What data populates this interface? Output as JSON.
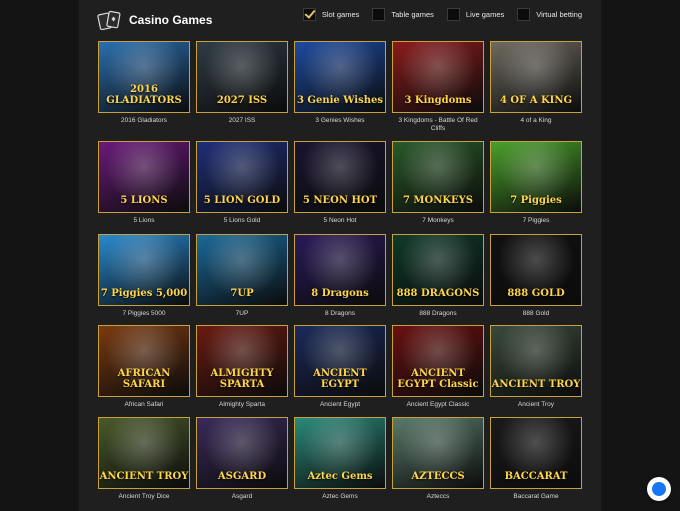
{
  "header": {
    "title": "Casino Games",
    "filters": [
      {
        "label": "Slot games",
        "checked": true
      },
      {
        "label": "Table games",
        "checked": false
      },
      {
        "label": "Live games",
        "checked": false
      },
      {
        "label": "Virtual betting",
        "checked": false
      }
    ]
  },
  "games": [
    {
      "name": "2016 Gladiators",
      "art": "2016 GLADIATORS",
      "bg": "#2a6fb0"
    },
    {
      "name": "2027 ISS",
      "art": "2027 ISS",
      "bg": "#2f3b45"
    },
    {
      "name": "3 Genies Wishes",
      "art": "3 Genie Wishes",
      "bg": "#1d4aa0"
    },
    {
      "name": "3 Kingdoms - Battle Of Red Cliffs",
      "art": "3 Kingdoms",
      "bg": "#8a1b1b"
    },
    {
      "name": "4 of a King",
      "art": "4 OF A KING",
      "bg": "#6e6a5f"
    },
    {
      "name": "5 Lions",
      "art": "5 LIONS",
      "bg": "#6a1a7a"
    },
    {
      "name": "5 Lions Gold",
      "art": "5 LION GOLD",
      "bg": "#1f2f7a"
    },
    {
      "name": "5 Neon Hot",
      "art": "5 NEON HOT",
      "bg": "#1a1430"
    },
    {
      "name": "7 Monkeys",
      "art": "7 MONKEYS",
      "bg": "#2a5a2a"
    },
    {
      "name": "7 Piggies",
      "art": "7 Piggies",
      "bg": "#4aa02a"
    },
    {
      "name": "7 Piggies 5000",
      "art": "7 Piggies 5,000",
      "bg": "#2a8ad0"
    },
    {
      "name": "7UP",
      "art": "7UP",
      "bg": "#1a6a9a"
    },
    {
      "name": "8 Dragons",
      "art": "8 Dragons",
      "bg": "#2a1a5a"
    },
    {
      "name": "888 Dragons",
      "art": "888 DRAGONS",
      "bg": "#0f3a2a"
    },
    {
      "name": "888 Gold",
      "art": "888 GOLD",
      "bg": "#111111"
    },
    {
      "name": "African Safari",
      "art": "AFRICAN SAFARI",
      "bg": "#7a3a10"
    },
    {
      "name": "Almighty Sparta",
      "art": "ALMIGHTY SPARTA",
      "bg": "#6a1a10"
    },
    {
      "name": "Ancient Egypt",
      "art": "ANCIENT EGYPT",
      "bg": "#1a2a5a"
    },
    {
      "name": "Ancient Egypt Classic",
      "art": "ANCIENT EGYPT Classic",
      "bg": "#6a1010"
    },
    {
      "name": "Ancient Troy",
      "art": "ANCIENT TROY",
      "bg": "#3a4a3a"
    },
    {
      "name": "Ancient Troy Dice",
      "art": "ANCIENT TROY",
      "bg": "#4a5a2a"
    },
    {
      "name": "Asgard",
      "art": "ASGARD",
      "bg": "#3a2a5a"
    },
    {
      "name": "Aztec Gems",
      "art": "Aztec Gems",
      "bg": "#2a8a7a"
    },
    {
      "name": "Azteccs",
      "art": "AZTECCS",
      "bg": "#5a7a6a"
    },
    {
      "name": "Baccarat Game",
      "art": "BACCARAT",
      "bg": "#1a1a1a"
    }
  ]
}
